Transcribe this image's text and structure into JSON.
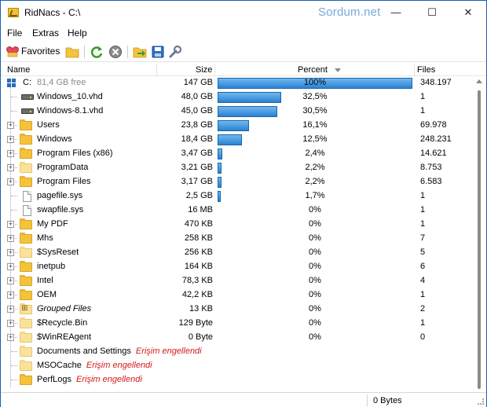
{
  "window": {
    "title": "RidNacs - C:\\",
    "watermark": "Sordum.net",
    "controls": [
      "—",
      "☐",
      "✕"
    ]
  },
  "menu": [
    "File",
    "Extras",
    "Help"
  ],
  "toolbar": {
    "favorites_label": "Favorites",
    "icons": [
      "heart-icon",
      "folder-open-icon",
      "refresh-icon",
      "stop-icon",
      "export-icon",
      "save-icon",
      "settings-wrench-icon"
    ]
  },
  "columns": {
    "name": "Name",
    "size": "Size",
    "percent": "Percent",
    "files": "Files"
  },
  "root": {
    "label": "C:",
    "free": "81,4 GB free",
    "size": "147 GB",
    "percent": "100%",
    "percent_value": 100,
    "files": "348.197"
  },
  "rows": [
    {
      "name": "Windows_10.vhd",
      "size": "48,0 GB",
      "percent": "32,5%",
      "percent_value": 32.5,
      "files": "1",
      "icon": "drive-icon",
      "expandable": false
    },
    {
      "name": "Windows-8.1.vhd",
      "size": "45,0 GB",
      "percent": "30,5%",
      "percent_value": 30.5,
      "files": "1",
      "icon": "drive-icon",
      "expandable": false
    },
    {
      "name": "Users",
      "size": "23,8 GB",
      "percent": "16,1%",
      "percent_value": 16.1,
      "files": "69.978",
      "icon": "folder-icon",
      "expandable": true
    },
    {
      "name": "Windows",
      "size": "18,4 GB",
      "percent": "12,5%",
      "percent_value": 12.5,
      "files": "248.231",
      "icon": "folder-icon",
      "expandable": true
    },
    {
      "name": "Program Files (x86)",
      "size": "3,47 GB",
      "percent": "2,4%",
      "percent_value": 2.4,
      "files": "14.621",
      "icon": "folder-icon",
      "expandable": true
    },
    {
      "name": "ProgramData",
      "size": "3,21 GB",
      "percent": "2,2%",
      "percent_value": 2.2,
      "files": "8.753",
      "icon": "folder-pale-icon",
      "expandable": true
    },
    {
      "name": "Program Files",
      "size": "3,17 GB",
      "percent": "2,2%",
      "percent_value": 2.2,
      "files": "6.583",
      "icon": "folder-icon",
      "expandable": true
    },
    {
      "name": "pagefile.sys",
      "size": "2,5 GB",
      "percent": "1,7%",
      "percent_value": 1.7,
      "files": "1",
      "icon": "system-file-icon",
      "expandable": false
    },
    {
      "name": "swapfile.sys",
      "size": "16 MB",
      "percent": "0%",
      "percent_value": 0,
      "files": "1",
      "icon": "system-file-icon",
      "expandable": false
    },
    {
      "name": "My PDF",
      "size": "470 KB",
      "percent": "0%",
      "percent_value": 0,
      "files": "1",
      "icon": "folder-icon",
      "expandable": true
    },
    {
      "name": "Mhs",
      "size": "258 KB",
      "percent": "0%",
      "percent_value": 0,
      "files": "7",
      "icon": "folder-icon",
      "expandable": true
    },
    {
      "name": "$SysReset",
      "size": "256 KB",
      "percent": "0%",
      "percent_value": 0,
      "files": "5",
      "icon": "folder-pale-icon",
      "expandable": true
    },
    {
      "name": "inetpub",
      "size": "164 KB",
      "percent": "0%",
      "percent_value": 0,
      "files": "6",
      "icon": "folder-icon",
      "expandable": true
    },
    {
      "name": "Intel",
      "size": "78,3 KB",
      "percent": "0%",
      "percent_value": 0,
      "files": "4",
      "icon": "folder-icon",
      "expandable": true
    },
    {
      "name": "OEM",
      "size": "42,2 KB",
      "percent": "0%",
      "percent_value": 0,
      "files": "1",
      "icon": "folder-icon",
      "expandable": true
    },
    {
      "name": "Grouped Files",
      "size": "13 KB",
      "percent": "0%",
      "percent_value": 0,
      "files": "2",
      "icon": "grouped-files-icon",
      "expandable": true,
      "italic": true
    },
    {
      "name": "$Recycle.Bin",
      "size": "129 Byte",
      "percent": "0%",
      "percent_value": 0,
      "files": "1",
      "icon": "folder-pale-icon",
      "expandable": true
    },
    {
      "name": "$WinREAgent",
      "size": "0 Byte",
      "percent": "0%",
      "percent_value": 0,
      "files": "0",
      "icon": "folder-pale-icon",
      "expandable": true
    },
    {
      "name": "Documents and Settings",
      "denied": "Erişim engellendi",
      "size": "",
      "percent": "",
      "percent_value": 0,
      "files": "",
      "icon": "folder-pale-icon",
      "expandable": false
    },
    {
      "name": "MSOCache",
      "denied": "Erişim engellendi",
      "size": "",
      "percent": "",
      "percent_value": 0,
      "files": "",
      "icon": "folder-pale-icon",
      "expandable": false
    },
    {
      "name": "PerfLogs",
      "denied": "Erişim engellendi",
      "size": "",
      "percent": "",
      "percent_value": 0,
      "files": "",
      "icon": "folder-icon",
      "expandable": false
    }
  ],
  "status": {
    "selection_size": "0 Bytes"
  }
}
